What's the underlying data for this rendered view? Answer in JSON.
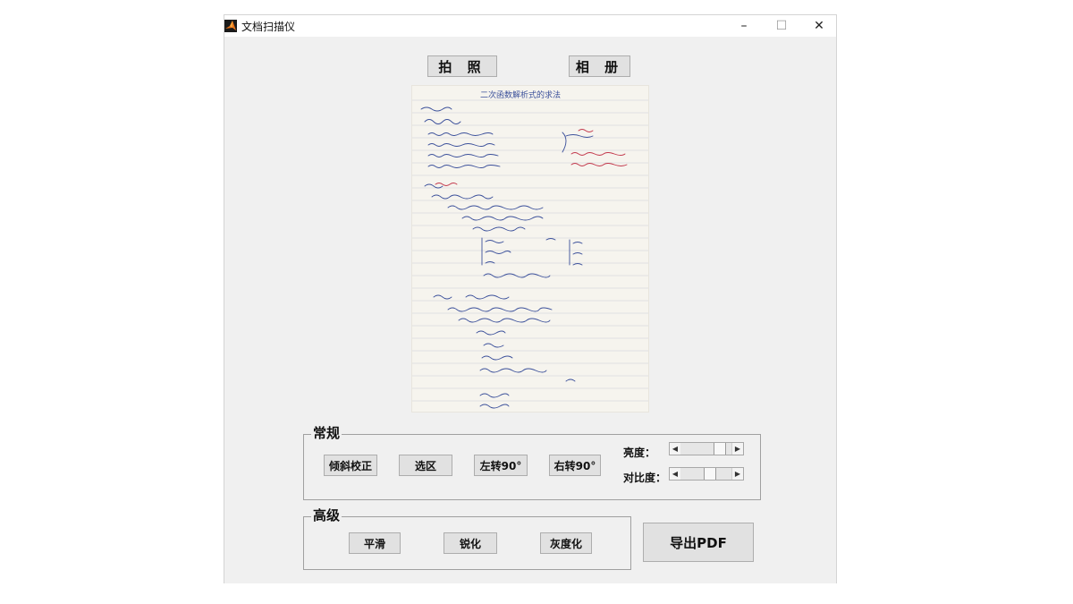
{
  "window": {
    "title": "文档扫描仪",
    "controls": {
      "minimize": "–",
      "maximize": "☐",
      "close": "✕"
    }
  },
  "top_buttons": {
    "camera": "拍 照",
    "album": "相 册"
  },
  "preview": {
    "handwritten_heading": "二次函数解析式的求法"
  },
  "general": {
    "title": "常规",
    "buttons": {
      "deskew": "倾斜校正",
      "select_region": "选区",
      "rotate_left": "左转90°",
      "rotate_right": "右转90°"
    },
    "brightness_label": "亮度：",
    "contrast_label": "对比度：",
    "brightness_level": 0.85,
    "contrast_level": 0.6
  },
  "advanced": {
    "title": "高级",
    "buttons": {
      "smooth": "平滑",
      "sharpen": "锐化",
      "grayscale": "灰度化"
    }
  },
  "export": {
    "label": "导出PDF"
  },
  "colors": {
    "accent_blue": "#3a4f9a",
    "accent_red": "#c2364a"
  }
}
